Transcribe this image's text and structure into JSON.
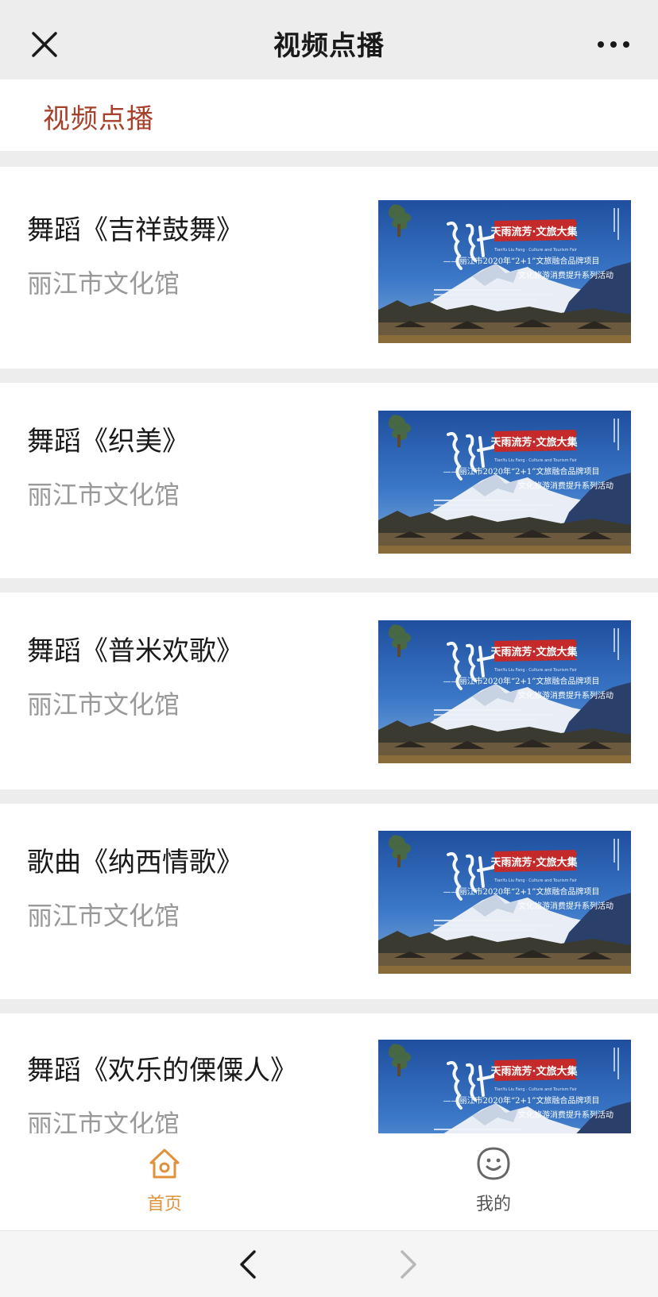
{
  "topbar": {
    "title": "视频点播"
  },
  "page_header": {
    "title": "视频点播"
  },
  "videos": [
    {
      "title": "舞蹈《吉祥鼓舞》",
      "source": "丽江市文化馆"
    },
    {
      "title": "舞蹈《织美》",
      "source": "丽江市文化馆"
    },
    {
      "title": "舞蹈《普米欢歌》",
      "source": "丽江市文化馆"
    },
    {
      "title": "歌曲《纳西情歌》",
      "source": "丽江市文化馆"
    },
    {
      "title": "舞蹈《欢乐的傈僳人》",
      "source": "丽江市文化馆"
    }
  ],
  "thumbnail": {
    "banner": "天雨流芳·文旅大集",
    "subtitle_en": "TianYu Liu Fang · Culture and Tourism Fair",
    "line1": "——丽江市2020年“2+1”文旅融合品牌项目",
    "line2": "文化旅游消费提升系列活动"
  },
  "tabbar": {
    "tabs": [
      {
        "label": "首页",
        "icon": "home-icon",
        "active": true
      },
      {
        "label": "我的",
        "icon": "smiley-icon",
        "active": false
      }
    ]
  },
  "colors": {
    "accent": "#e0923a",
    "header_title": "#a6412b",
    "inactive": "#555555"
  }
}
